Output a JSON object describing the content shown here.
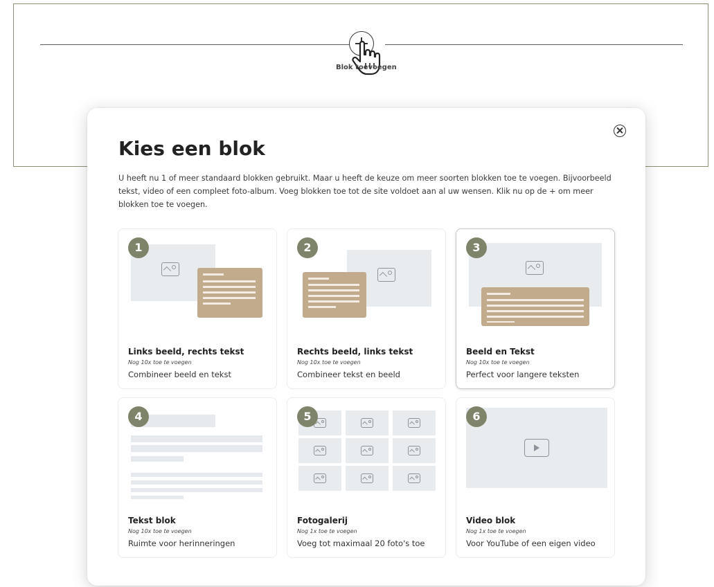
{
  "editor": {
    "add_block_label": "Blok toevoegen"
  },
  "modal": {
    "title": "Kies een blok",
    "description": "U heeft nu 1 of meer standaard blokken gebruikt. Maar u heeft de keuze om meer soorten blokken toe te voegen. Bijvoorbeeld tekst, video of een compleet foto-album. Voeg blokken toe tot de site voldoet aan al uw wensen. Klik nu op de + om meer blokken toe te voegen.",
    "close_icon": "close-icon"
  },
  "cards": [
    {
      "number": "1",
      "name": "Links beeld, rechts tekst",
      "count": "Nog 10x toe te voegen",
      "subtitle": "Combineer beeld en tekst"
    },
    {
      "number": "2",
      "name": "Rechts beeld, links tekst",
      "count": "Nog 10x toe te voegen",
      "subtitle": "Combineer tekst en beeld"
    },
    {
      "number": "3",
      "name": "Beeld en Tekst",
      "count": "Nog 10x toe te voegen",
      "subtitle": "Perfect voor langere teksten"
    },
    {
      "number": "4",
      "name": "Tekst blok",
      "count": "Nog 10x toe te voegen",
      "subtitle": "Ruimte voor herinneringen"
    },
    {
      "number": "5",
      "name": "Fotogalerij",
      "count": "Nog 1x toe te voegen",
      "subtitle": "Voeg tot maximaal 20 foto's toe"
    },
    {
      "number": "6",
      "name": "Video blok",
      "count": "Nog 1x toe te voegen",
      "subtitle": "Voor YouTube of een eigen video"
    }
  ],
  "colors": {
    "badge": "#7e8469",
    "tan_block": "#c2aa8c",
    "image_placeholder": "#e8ecef",
    "frame_border": "#8a9072"
  }
}
